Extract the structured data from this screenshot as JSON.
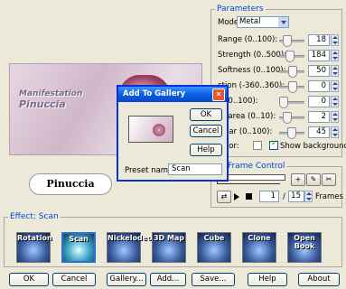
{
  "parameters": {
    "title": "Parameters",
    "mode_label": "Mode",
    "mode_value": "Metal",
    "rows": [
      {
        "label": "Range (0..100):",
        "value": "18",
        "level": 0.18
      },
      {
        "label": "Strength (0..500):",
        "value": "184",
        "level": 0.37
      },
      {
        "label": "Softness (0..100):",
        "value": "50",
        "level": 0.5
      },
      {
        "label": "ction (-360..360):",
        "value": "0",
        "level": 0.5
      },
      {
        "label": "n (0..100):",
        "value": "0",
        "level": 0.0
      },
      {
        "label": "nt area (0..10):",
        "value": "2",
        "level": 0.2
      },
      {
        "label": "cular (0..100):",
        "value": "45",
        "level": 0.45
      }
    ],
    "color_label": "color:",
    "show_background_label": "Show background",
    "show_background_checked": true
  },
  "frame_control": {
    "title": "Frame Control",
    "frame_value": "1",
    "of_label": "/",
    "total_frames": "15",
    "frames_label": "Frames"
  },
  "preview": {
    "logo_text": "Pinuccia",
    "watermark_line1": "Manifestation",
    "watermark_line2": "Pinuccia"
  },
  "dialog": {
    "title": "Add To Gallery",
    "close_glyph": "✕",
    "ok_label": "OK",
    "cancel_label": "Cancel",
    "help_label": "Help",
    "preset_name_label": "Preset name:",
    "preset_name_value": "Scan"
  },
  "effects": {
    "title": "Effect: Scan",
    "items": [
      {
        "label": "Rotation",
        "selected": false
      },
      {
        "label": "Scan",
        "selected": true
      },
      {
        "label": "Nickelodeon",
        "selected": false
      },
      {
        "label": "3D Map",
        "selected": false
      },
      {
        "label": "Cube",
        "selected": false
      },
      {
        "label": "Clone",
        "selected": false
      },
      {
        "label": "Open Book",
        "selected": false
      }
    ]
  },
  "footer": {
    "ok": "OK",
    "cancel": "Cancel",
    "gallery": "Gallery...",
    "add": "Add...",
    "save": "Save...",
    "help": "Help",
    "about": "About"
  }
}
